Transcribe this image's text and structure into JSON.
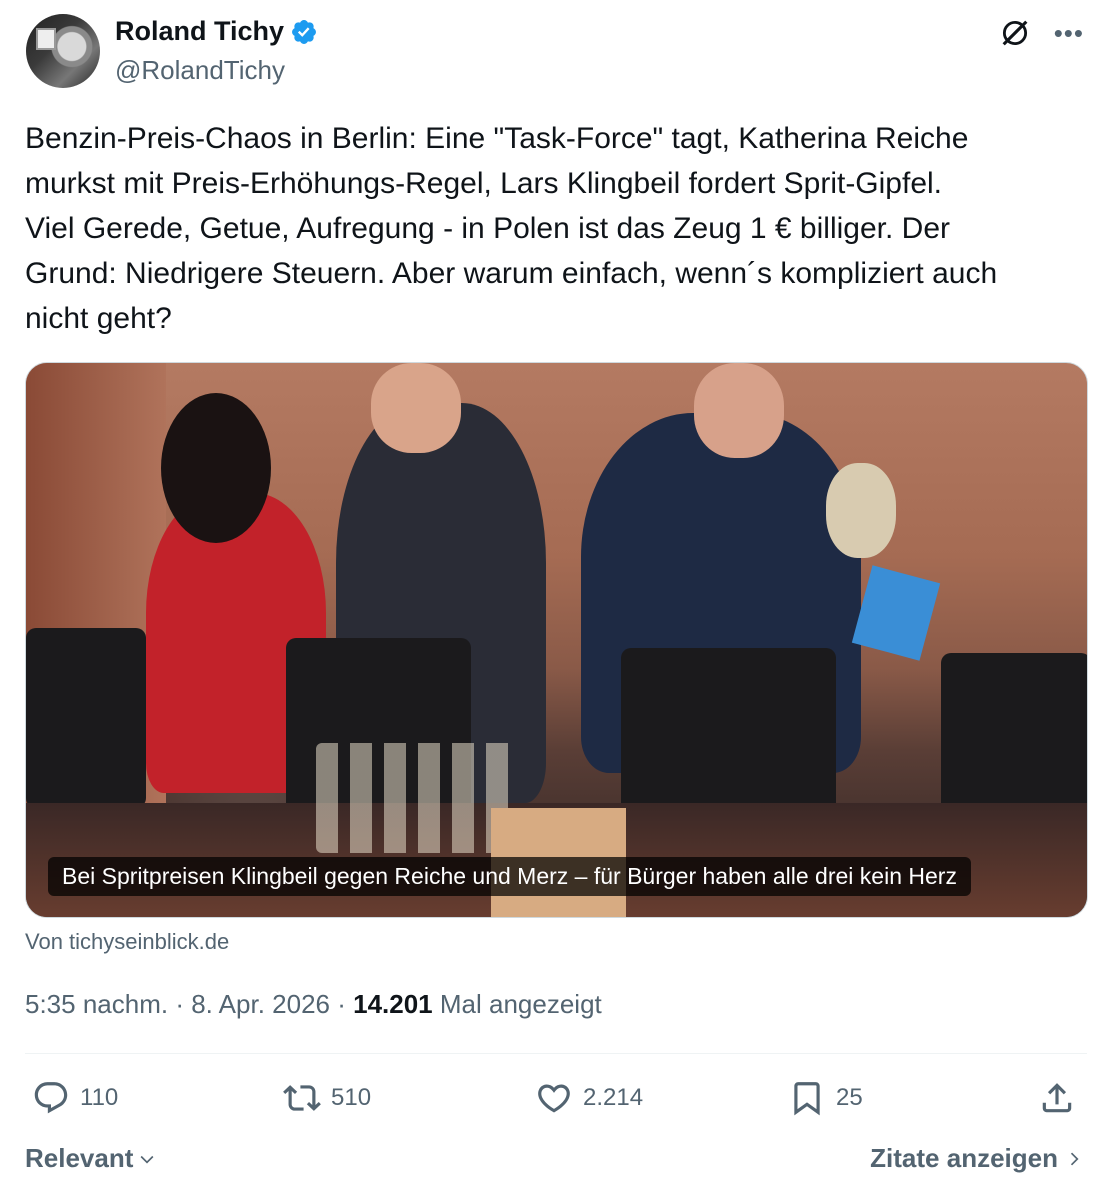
{
  "author": {
    "name": "Roland Tichy",
    "handle": "@RolandTichy",
    "verified": true
  },
  "tweet": {
    "text": "Benzin-Preis-Chaos in Berlin: Eine \"Task-Force\" tagt, Katherina Reiche\nmurkst mit Preis-Erhöhungs-Regel, Lars Klingbeil fordert Sprit-Gipfel.\nViel Gerede, Getue, Aufregung - in Polen ist das Zeug 1 € billiger. Der\nGrund: Niedrigere Steuern. Aber warum einfach, wenn´s kompliziert auch\nnicht geht?"
  },
  "link_card": {
    "caption": "Bei Spritpreisen Klingbeil gegen Reiche und Merz – für Bürger haben alle drei kein Herz",
    "source": "Von tichyseinblick.de"
  },
  "meta": {
    "time": "5:35 nachm.",
    "separator": " · ",
    "date": "8. Apr. 2026",
    "views": "14.201",
    "views_label": "Mal angezeigt"
  },
  "actions": {
    "replies": "110",
    "retweets": "510",
    "likes": "2.214",
    "bookmarks": "25"
  },
  "footer": {
    "sort_label": "Relevant",
    "quotes_label": "Zitate anzeigen"
  },
  "colors": {
    "verified_blue": "#1d9bf0",
    "secondary_text": "#536471",
    "primary_text": "#0f1419"
  },
  "icons": [
    "verified-badge-icon",
    "grok-icon",
    "more-icon",
    "reply-icon",
    "retweet-icon",
    "like-icon",
    "bookmark-icon",
    "share-icon",
    "chevron-down-icon",
    "chevron-right-icon"
  ]
}
